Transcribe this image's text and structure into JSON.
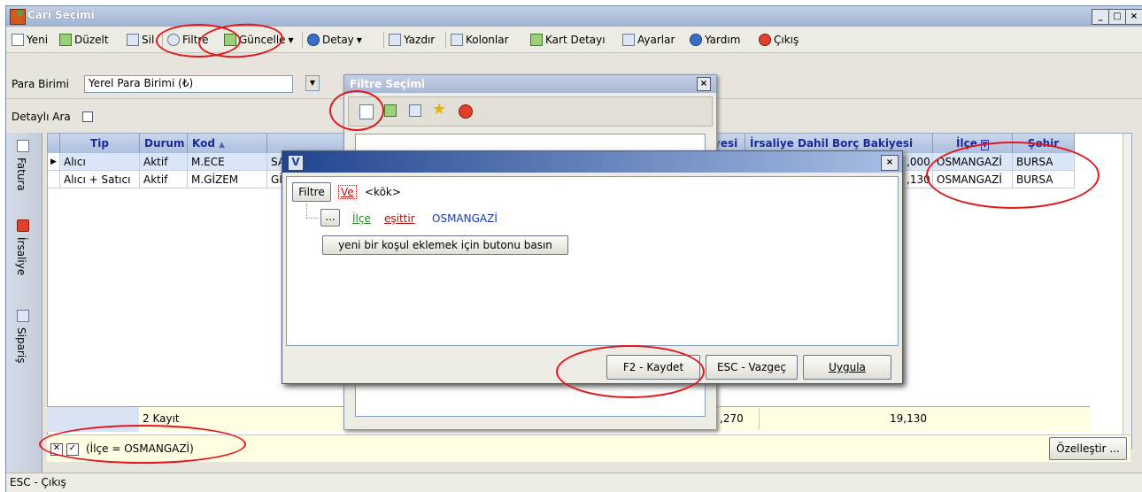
{
  "window": {
    "title": "Cari Seçimi"
  },
  "toolbar": {
    "yeni": "Yeni",
    "duzelt": "Düzelt",
    "sil": "Sil",
    "filtre": "Filtre",
    "guncelle": "Güncelle",
    "detay": "Detay",
    "yazdir": "Yazdır",
    "kolonlar": "Kolonlar",
    "kart_detayi": "Kart Detayı",
    "ayarlar": "Ayarlar",
    "yardim": "Yardım",
    "cikis": "Çıkış"
  },
  "params": {
    "para_birimi_label": "Para Birimi",
    "para_birimi_value": "Yerel Para Birimi (₺)",
    "detayli_ara_label": "Detaylı Ara"
  },
  "sidebar": {
    "fatura": "Fatura",
    "irsaliye": "İrsaliye",
    "siparis": "Sipariş"
  },
  "grid": {
    "headers": {
      "tip": "Tip",
      "durum": "Durum",
      "kod": "Kod",
      "bakiye": "yesi",
      "irsaliye_borc": "İrsaliye Dahil Borç Bakiyesi",
      "ilce": "İlçe",
      "sehir": "Şehir"
    },
    "rows": [
      {
        "tip": "Alıcı",
        "durum": "Aktif",
        "kod": "M.ECE",
        "ad": "SA",
        "bakiye": ",000",
        "ilce": "OSMANGAZİ",
        "sehir": "BURSA"
      },
      {
        "tip": "Alıcı + Satıcı",
        "durum": "Aktif",
        "kod": "M.GİZEM",
        "ad": "Gİ",
        "bakiye": ",130",
        "ilce": "OSMANGAZİ",
        "sehir": "BURSA"
      }
    ],
    "footer": {
      "count": "2 Kayıt",
      "total1": ",270",
      "total2": "19,130"
    }
  },
  "filterbar": {
    "expression": "(İlçe = OSMANGAZİ)",
    "customize": "Özelleştir ..."
  },
  "status": {
    "text": "ESC - Çıkış"
  },
  "filter_select": {
    "title": "Filtre Seçimi"
  },
  "editor": {
    "filtre_btn": "Filtre",
    "ve": "Ve",
    "kok": "<kök>",
    "dots": "...",
    "field": "İlçe",
    "op": "eşittir",
    "value": "OSMANGAZİ",
    "add_condition": "yeni bir koşul eklemek için butonu basın",
    "save": "F2 - Kaydet",
    "cancel": "ESC - Vazgeç",
    "apply": "Uygula"
  },
  "colors": {
    "annotation": "#e3161e",
    "title_blue": "#20448f",
    "header_text": "#1a2a9a"
  }
}
